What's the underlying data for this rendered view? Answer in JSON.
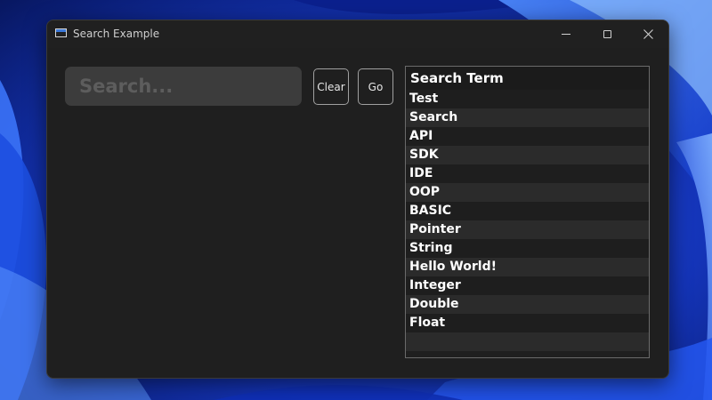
{
  "window": {
    "title": "Search Example"
  },
  "search": {
    "placeholder": "Search...",
    "value": ""
  },
  "buttons": {
    "clear_label": "Clear",
    "go_label": "Go"
  },
  "list": {
    "header": "Search Term",
    "items": [
      "Test",
      "Search",
      "API",
      "SDK",
      "IDE",
      "OOP",
      "BASIC",
      "Pointer",
      "String",
      "Hello World!",
      "Integer",
      "Double",
      "Float",
      ""
    ]
  },
  "colors": {
    "window_bg": "#1f1f1f",
    "input_bg": "#3c3c3c",
    "row_alt": "#2b2b2b",
    "accent_icon": "#3b78d8"
  },
  "icons": {
    "app": "window-icon",
    "minimize": "minimize-icon",
    "maximize": "maximize-icon",
    "close": "close-icon"
  }
}
